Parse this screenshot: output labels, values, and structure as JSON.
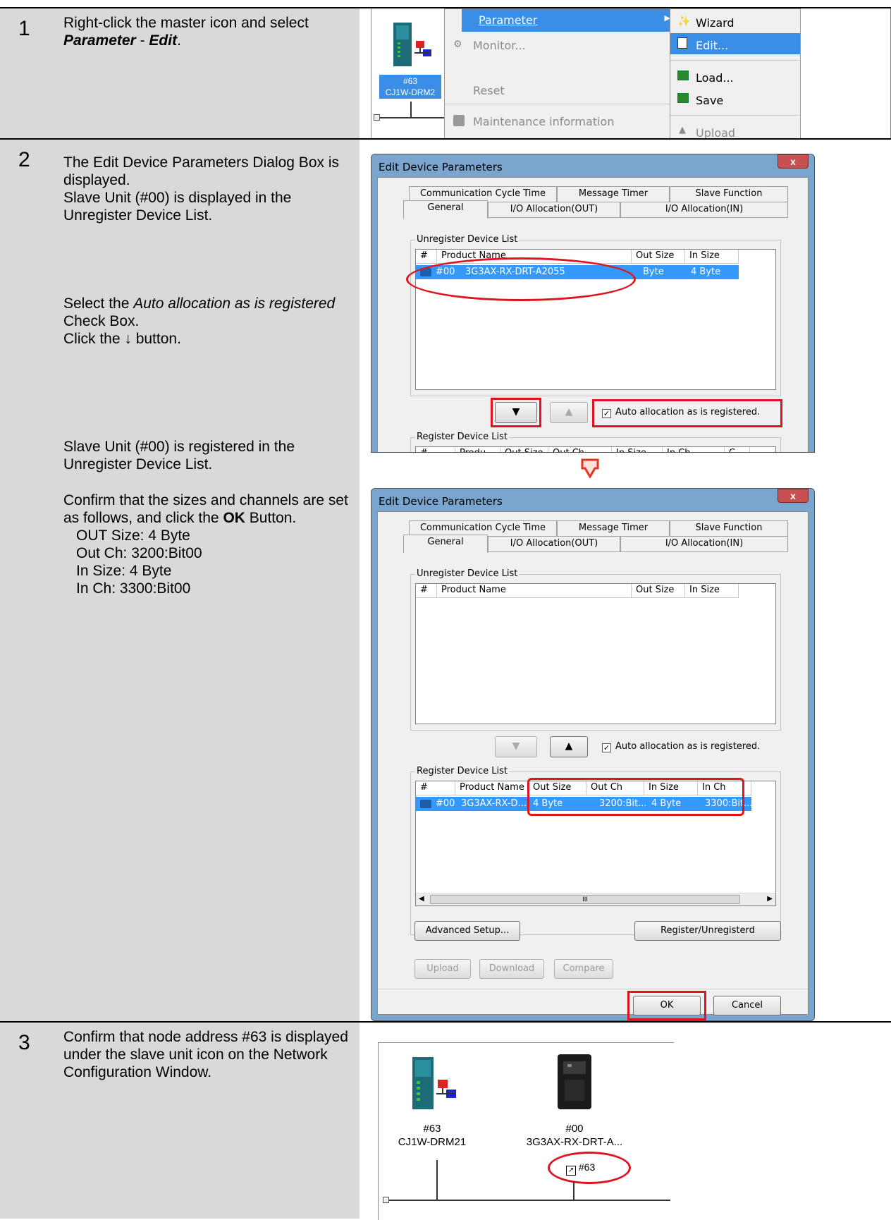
{
  "steps": [
    {
      "num": "1",
      "desc_parts": [
        "Right-click the master icon and select ",
        "Parameter",
        " - ",
        "Edit",
        "."
      ],
      "menu": {
        "device_num": "#63",
        "device_name": "CJ1W-DRM2",
        "items": [
          "Parameter",
          "Monitor...",
          "Reset",
          "Maintenance information"
        ],
        "submenu": [
          "Wizard",
          "Edit...",
          "Load...",
          "Save",
          "Upload"
        ]
      }
    },
    {
      "num": "2",
      "desc_a": "The Edit Device Parameters Dialog Box is displayed.",
      "desc_b": "Slave Unit (#00) is displayed in the Unregister Device List.",
      "desc_c_parts": [
        "Select the ",
        "Auto allocation as is registered",
        " Check Box."
      ],
      "desc_d": "Click the ↓ button.",
      "desc_e": "Slave Unit (#00) is registered in the Unregister Device List.",
      "desc_f_parts": [
        "Confirm that the sizes and channels are set as follows, and click the ",
        "OK",
        " Button."
      ],
      "settings": [
        "OUT Size: 4 Byte",
        "Out Ch: 3200:Bit00",
        "In Size: 4 Byte",
        "In Ch: 3300:Bit00"
      ]
    },
    {
      "num": "3",
      "desc": "Confirm that node address #63 is displayed under the slave unit icon on the Network Configuration Window.",
      "devices": [
        {
          "num": "#63",
          "name": "CJ1W-DRM21"
        },
        {
          "num": "#00",
          "name": "3G3AX-RX-DRT-A..."
        }
      ],
      "node_label": "#63"
    }
  ],
  "dialog": {
    "title": "Edit Device Parameters",
    "close": "x",
    "tabs_top": [
      "Communication Cycle Time",
      "Message Timer",
      "Slave Function"
    ],
    "tabs_bottom": [
      "General",
      "I/O Allocation(OUT)",
      "I/O Allocation(IN)"
    ],
    "unreg_label": "Unregister Device List",
    "reg_label": "Register Device List",
    "unreg_headers": [
      "#",
      "Product Name",
      "Out Size",
      "In Size"
    ],
    "unreg_row": [
      "#00",
      "3G3AX-RX-DRT-A2055",
      "Byte",
      "4 Byte"
    ],
    "reg_headers_a": [
      "#",
      "Produ...",
      "Out Size",
      "Out Ch",
      "In Size",
      "In Ch",
      "C"
    ],
    "reg_headers_b": [
      "#",
      "Product Name",
      "Out Size",
      "Out Ch",
      "In Size",
      "In Ch"
    ],
    "reg_row": [
      "#00",
      "3G3AX-RX-D...",
      "4 Byte",
      "3200:Bit...",
      "4 Byte",
      "3300:Bit..."
    ],
    "auto_alloc": "Auto allocation as is registered.",
    "scroll_mid": "III",
    "btn_advanced": "Advanced Setup...",
    "btn_register": "Register/Unregisterd",
    "btn_upload": "Upload",
    "btn_download": "Download",
    "btn_compare": "Compare",
    "btn_ok": "OK",
    "btn_cancel": "Cancel"
  },
  "colors": {
    "highlight": "#e0141e",
    "selection": "#3399ff",
    "menu_selection": "#3b8ee5",
    "arrow": "#e8321e"
  }
}
